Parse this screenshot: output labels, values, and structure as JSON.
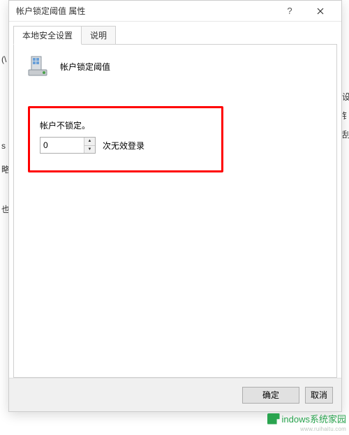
{
  "dialog": {
    "title": "帐户锁定阈值 属性",
    "help_icon": "?",
    "close_icon": "×"
  },
  "tabs": [
    {
      "label": "本地安全设置",
      "active": true
    },
    {
      "label": "说明",
      "active": false
    }
  ],
  "policy": {
    "title": "帐户锁定阈值"
  },
  "setting": {
    "status_text": "帐户不锁定。",
    "value": "0",
    "suffix": "次无效登录"
  },
  "buttons": {
    "ok": "确定",
    "cancel": "取消"
  },
  "watermark": {
    "text": "indows系统家园",
    "url": "www.ruihaitu.com"
  },
  "left_fragments": [
    "(\\",
    "s",
    "略",
    "也"
  ],
  "right_fragments": [
    "设",
    "钅",
    "刮"
  ]
}
